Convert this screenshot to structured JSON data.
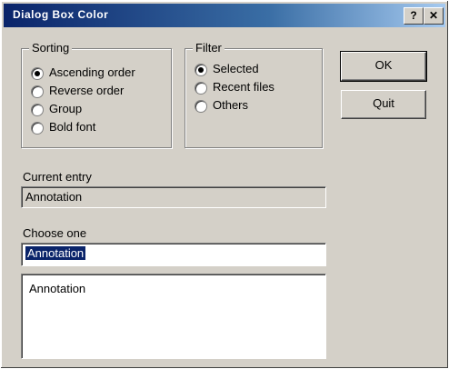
{
  "window": {
    "title": "Dialog Box Color",
    "help_glyph": "?",
    "close_glyph": "✕"
  },
  "colors": {
    "face": "#d4d0c8",
    "title_gradient_start": "#0a246a",
    "title_gradient_end": "#a6caf0",
    "selection": "#0a246a"
  },
  "group_left": {
    "title": "Sorting",
    "options": [
      {
        "label": "Ascending order",
        "selected": true
      },
      {
        "label": "Reverse order",
        "selected": false
      },
      {
        "label": "Group",
        "selected": false
      },
      {
        "label": "Bold font",
        "selected": false
      }
    ]
  },
  "group_right": {
    "title": "Filter",
    "options": [
      {
        "label": "Selected",
        "selected": true
      },
      {
        "label": "Recent files",
        "selected": false
      },
      {
        "label": "Others",
        "selected": false
      }
    ]
  },
  "buttons": {
    "ok": "OK",
    "cancel": "Quit"
  },
  "current_field": {
    "label": "Current entry",
    "value": "Annotation"
  },
  "select_field": {
    "label": "Choose one",
    "value": "Annotation"
  },
  "list": {
    "items": [
      "Annotation"
    ]
  }
}
